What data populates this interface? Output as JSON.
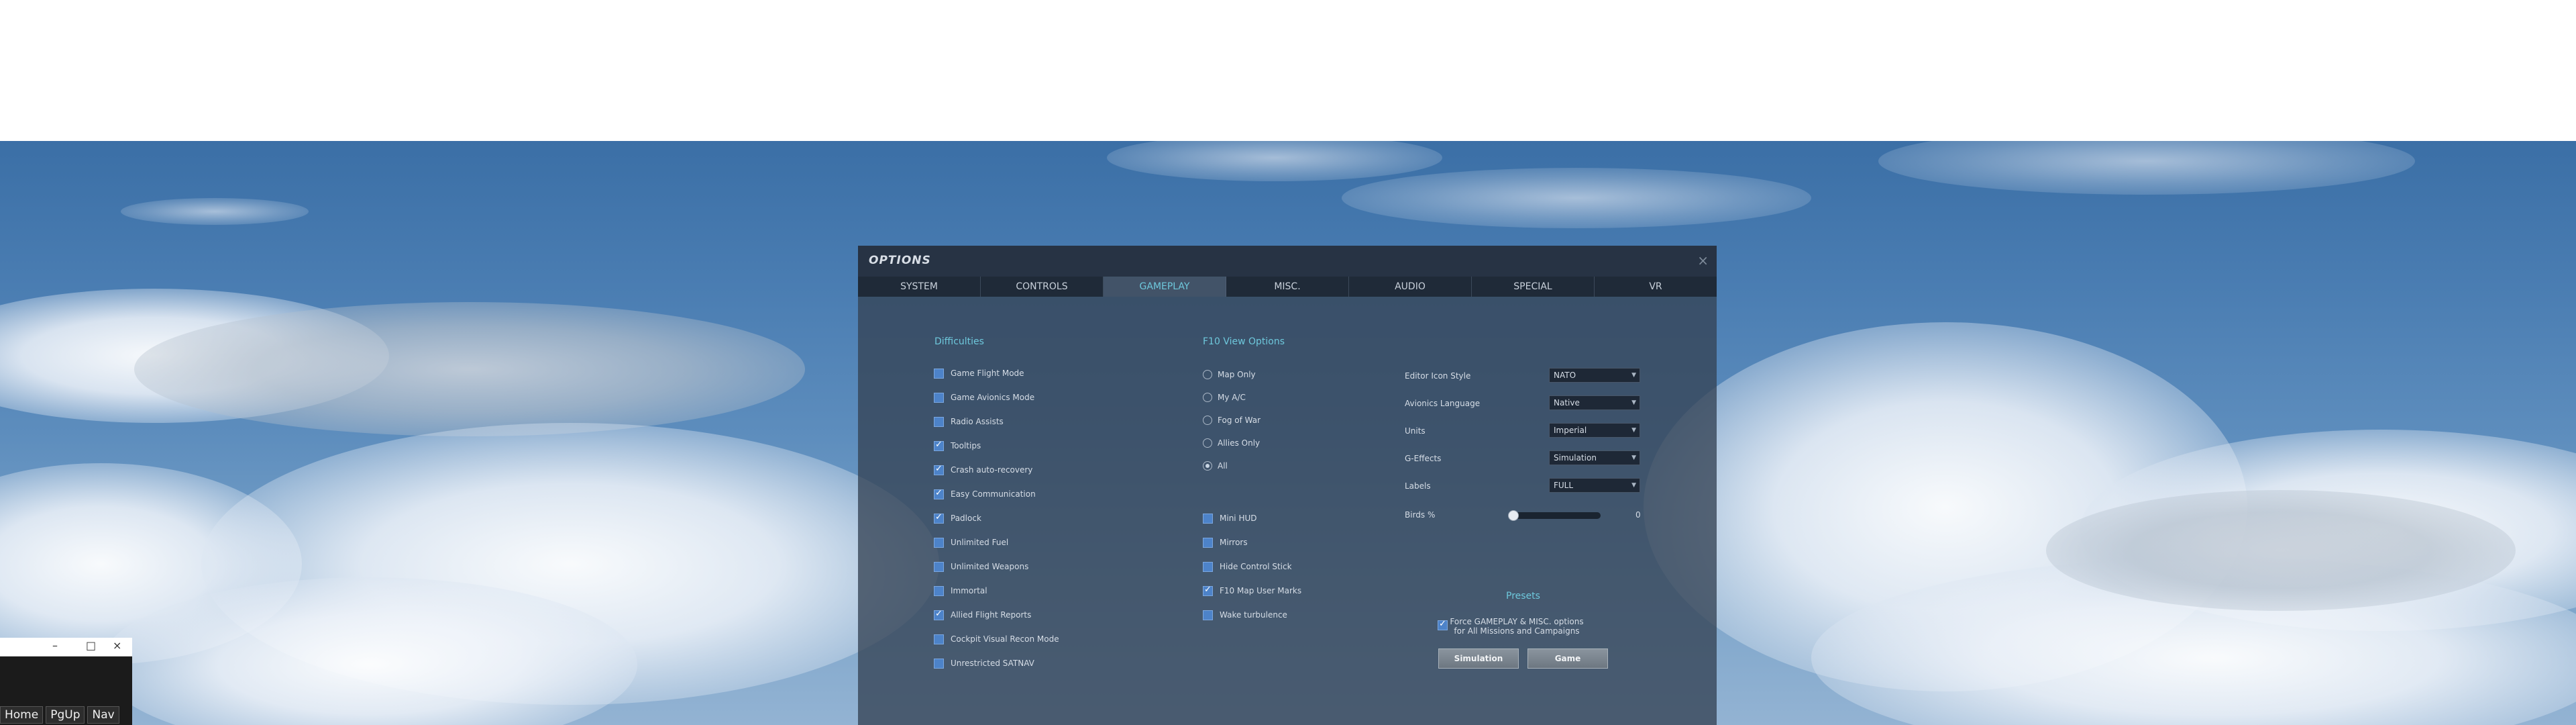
{
  "dialog": {
    "title": "OPTIONS",
    "close_glyph": "×",
    "tabs": [
      {
        "label": "SYSTEM",
        "active": false
      },
      {
        "label": "CONTROLS",
        "active": false
      },
      {
        "label": "GAMEPLAY",
        "active": true
      },
      {
        "label": "MISC.",
        "active": false
      },
      {
        "label": "AUDIO",
        "active": false
      },
      {
        "label": "SPECIAL",
        "active": false
      },
      {
        "label": "VR",
        "active": false
      }
    ]
  },
  "difficulties": {
    "title": "Difficulties",
    "items": [
      {
        "label": "Game Flight Mode",
        "checked": false
      },
      {
        "label": "Game Avionics Mode",
        "checked": false
      },
      {
        "label": "Radio Assists",
        "checked": false
      },
      {
        "label": "Tooltips",
        "checked": true
      },
      {
        "label": "Crash auto-recovery",
        "checked": true
      },
      {
        "label": "Easy Communication",
        "checked": true
      },
      {
        "label": "Padlock",
        "checked": true
      },
      {
        "label": "Unlimited Fuel",
        "checked": false
      },
      {
        "label": "Unlimited Weapons",
        "checked": false
      },
      {
        "label": "Immortal",
        "checked": false
      },
      {
        "label": "Allied Flight Reports",
        "checked": true
      },
      {
        "label": "Cockpit Visual Recon Mode",
        "checked": false
      },
      {
        "label": "Unrestricted SATNAV",
        "checked": false
      }
    ]
  },
  "f10": {
    "title": "F10 View Options",
    "radios": [
      {
        "label": "Map Only",
        "checked": false
      },
      {
        "label": "My A/C",
        "checked": false
      },
      {
        "label": "Fog of War",
        "checked": false
      },
      {
        "label": "Allies Only",
        "checked": false
      },
      {
        "label": "All",
        "checked": true
      }
    ],
    "checks": [
      {
        "label": "Mini HUD",
        "checked": false
      },
      {
        "label": "Mirrors",
        "checked": false
      },
      {
        "label": "Hide Control Stick",
        "checked": false
      },
      {
        "label": "F10 Map User Marks",
        "checked": true
      },
      {
        "label": "Wake turbulence",
        "checked": false
      }
    ]
  },
  "settings": {
    "editor_icon_style": {
      "label": "Editor Icon Style",
      "value": "NATO"
    },
    "avionics_language": {
      "label": "Avionics Language",
      "value": "Native"
    },
    "units": {
      "label": "Units",
      "value": "Imperial"
    },
    "g_effects": {
      "label": "G-Effects",
      "value": "Simulation"
    },
    "labels": {
      "label": "Labels",
      "value": "FULL"
    },
    "birds": {
      "label": "Birds %",
      "value": "0",
      "fraction": 0
    }
  },
  "presets": {
    "title": "Presets",
    "force_checked": true,
    "force_line1": "Force GAMEPLAY & MISC. options",
    "force_line2": "for All Missions and Campaigns",
    "simulation_label": "Simulation",
    "game_label": "Game"
  },
  "mini_window": {
    "min_glyph": "–",
    "max_glyph": "□",
    "close_glyph": "×",
    "keys": [
      "Home",
      "PgUp",
      "Nav"
    ]
  },
  "colors": {
    "accent": "#6ec8dc",
    "checkbox": "#4d83c9"
  }
}
